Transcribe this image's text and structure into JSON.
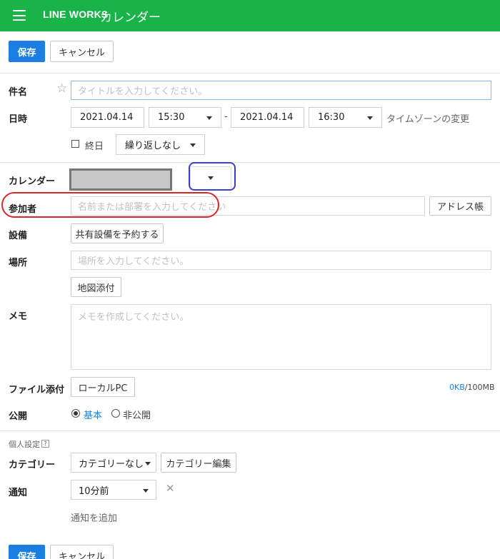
{
  "header": {
    "brand": "LINE WORKS",
    "title": "カレンダー",
    "color": "#19b34a"
  },
  "toolbar": {
    "save_label": "保存",
    "cancel_label": "キャンセル"
  },
  "form": {
    "subject": {
      "label": "件名",
      "placeholder": "タイトルを入力してください。"
    },
    "datetime": {
      "label": "日時",
      "start_date": "2021.04.14",
      "start_time": "15:30",
      "separator": "-",
      "end_date": "2021.04.14",
      "end_time": "16:30",
      "timezone_link": "タイムゾーンの変更",
      "allday_label": "終日",
      "repeat_value": "繰り返しなし"
    },
    "calendar": {
      "label": "カレンダー"
    },
    "attendees": {
      "label": "参加者",
      "placeholder": "名前または部署を入力してください",
      "address_book": "アドレス帳"
    },
    "equipment": {
      "label": "設備",
      "button": "共有設備を予約する"
    },
    "location": {
      "label": "場所",
      "placeholder": "場所を入力してください。",
      "map_button": "地図添付"
    },
    "memo": {
      "label": "メモ",
      "placeholder": "メモを作成してください。"
    },
    "attachment": {
      "label": "ファイル添付",
      "button": "ローカルPC",
      "used": "0KB",
      "limit": "/100MB"
    },
    "visibility": {
      "label": "公開",
      "basic": "基本",
      "private": "非公開"
    },
    "personal": {
      "section_label": "個人設定",
      "help": "?",
      "category_label": "カテゴリー",
      "category_value": "カテゴリーなし",
      "category_edit": "カテゴリー編集",
      "notify_label": "通知",
      "notify_value": "10分前",
      "add_notify": "通知を追加"
    }
  },
  "annotations": {
    "blue": "#3b3fcf",
    "red": "#e02424"
  }
}
